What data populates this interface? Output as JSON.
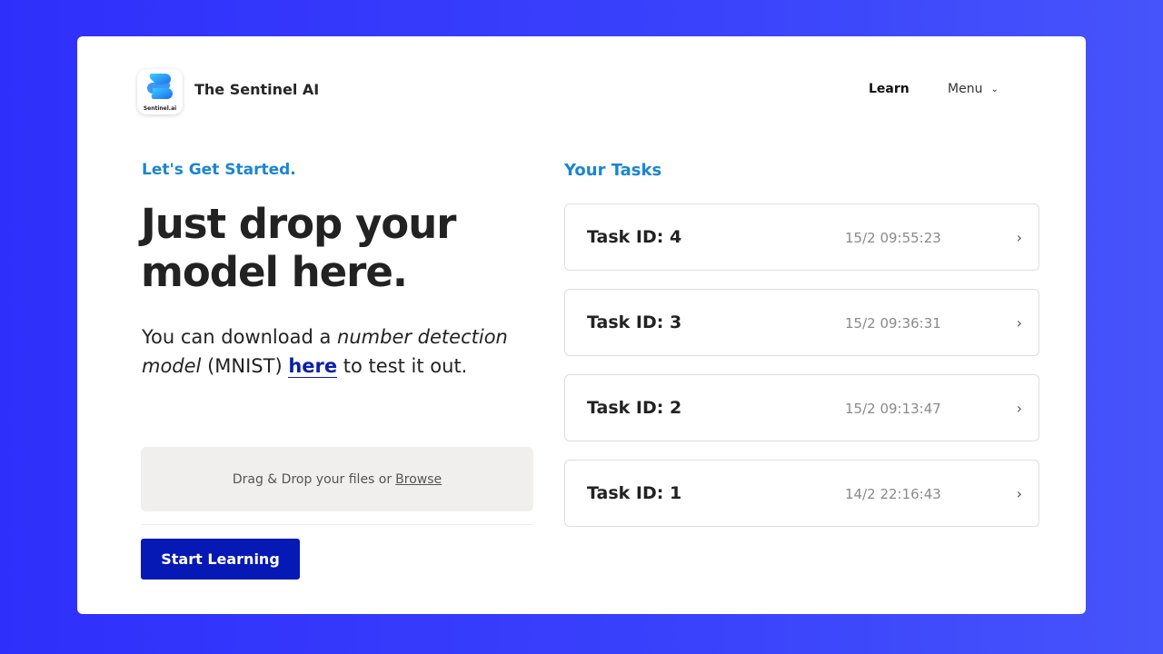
{
  "header": {
    "logo_caption": "Sentinel.ai",
    "brand_name": "The Sentinel AI",
    "nav_learn": "Learn",
    "nav_menu": "Menu"
  },
  "hero": {
    "kicker": "Let's Get Started.",
    "headline": "Just drop your model here.",
    "desc_part1": "You can download a ",
    "desc_em": "number detection model",
    "desc_part2": " (MNIST) ",
    "desc_link": "here",
    "desc_part3": " to test it out."
  },
  "upload": {
    "prompt": "Drag & Drop your files or",
    "browse_label": "Browse"
  },
  "start_button": "Start Learning",
  "tasks": {
    "title": "Your Tasks",
    "items": [
      {
        "id": "Task ID: 4",
        "time": "15/2 09:55:23"
      },
      {
        "id": "Task ID: 3",
        "time": "15/2 09:36:31"
      },
      {
        "id": "Task ID: 2",
        "time": "15/2 09:13:47"
      },
      {
        "id": "Task ID: 1",
        "time": "14/2 22:16:43"
      }
    ]
  },
  "colors": {
    "accent_blue": "#1a86d0",
    "button_blue": "#0719b4",
    "link_blue": "#0a1fa8",
    "background_gradient_start": "#2f2ffb",
    "background_gradient_end": "#4654fb"
  },
  "icons": {
    "logo": "sentinel-logo-icon",
    "menu_dropdown": "chevron-down-icon",
    "task_chevron": "chevron-right-icon"
  }
}
